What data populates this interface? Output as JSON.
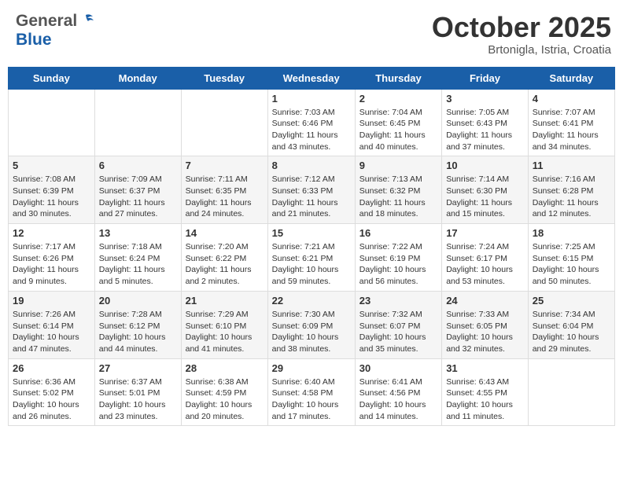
{
  "header": {
    "logo_general": "General",
    "logo_blue": "Blue",
    "month": "October 2025",
    "location": "Brtonigla, Istria, Croatia"
  },
  "weekdays": [
    "Sunday",
    "Monday",
    "Tuesday",
    "Wednesday",
    "Thursday",
    "Friday",
    "Saturday"
  ],
  "weeks": [
    [
      {
        "day": "",
        "info": ""
      },
      {
        "day": "",
        "info": ""
      },
      {
        "day": "",
        "info": ""
      },
      {
        "day": "1",
        "info": "Sunrise: 7:03 AM\nSunset: 6:46 PM\nDaylight: 11 hours\nand 43 minutes."
      },
      {
        "day": "2",
        "info": "Sunrise: 7:04 AM\nSunset: 6:45 PM\nDaylight: 11 hours\nand 40 minutes."
      },
      {
        "day": "3",
        "info": "Sunrise: 7:05 AM\nSunset: 6:43 PM\nDaylight: 11 hours\nand 37 minutes."
      },
      {
        "day": "4",
        "info": "Sunrise: 7:07 AM\nSunset: 6:41 PM\nDaylight: 11 hours\nand 34 minutes."
      }
    ],
    [
      {
        "day": "5",
        "info": "Sunrise: 7:08 AM\nSunset: 6:39 PM\nDaylight: 11 hours\nand 30 minutes."
      },
      {
        "day": "6",
        "info": "Sunrise: 7:09 AM\nSunset: 6:37 PM\nDaylight: 11 hours\nand 27 minutes."
      },
      {
        "day": "7",
        "info": "Sunrise: 7:11 AM\nSunset: 6:35 PM\nDaylight: 11 hours\nand 24 minutes."
      },
      {
        "day": "8",
        "info": "Sunrise: 7:12 AM\nSunset: 6:33 PM\nDaylight: 11 hours\nand 21 minutes."
      },
      {
        "day": "9",
        "info": "Sunrise: 7:13 AM\nSunset: 6:32 PM\nDaylight: 11 hours\nand 18 minutes."
      },
      {
        "day": "10",
        "info": "Sunrise: 7:14 AM\nSunset: 6:30 PM\nDaylight: 11 hours\nand 15 minutes."
      },
      {
        "day": "11",
        "info": "Sunrise: 7:16 AM\nSunset: 6:28 PM\nDaylight: 11 hours\nand 12 minutes."
      }
    ],
    [
      {
        "day": "12",
        "info": "Sunrise: 7:17 AM\nSunset: 6:26 PM\nDaylight: 11 hours\nand 9 minutes."
      },
      {
        "day": "13",
        "info": "Sunrise: 7:18 AM\nSunset: 6:24 PM\nDaylight: 11 hours\nand 5 minutes."
      },
      {
        "day": "14",
        "info": "Sunrise: 7:20 AM\nSunset: 6:22 PM\nDaylight: 11 hours\nand 2 minutes."
      },
      {
        "day": "15",
        "info": "Sunrise: 7:21 AM\nSunset: 6:21 PM\nDaylight: 10 hours\nand 59 minutes."
      },
      {
        "day": "16",
        "info": "Sunrise: 7:22 AM\nSunset: 6:19 PM\nDaylight: 10 hours\nand 56 minutes."
      },
      {
        "day": "17",
        "info": "Sunrise: 7:24 AM\nSunset: 6:17 PM\nDaylight: 10 hours\nand 53 minutes."
      },
      {
        "day": "18",
        "info": "Sunrise: 7:25 AM\nSunset: 6:15 PM\nDaylight: 10 hours\nand 50 minutes."
      }
    ],
    [
      {
        "day": "19",
        "info": "Sunrise: 7:26 AM\nSunset: 6:14 PM\nDaylight: 10 hours\nand 47 minutes."
      },
      {
        "day": "20",
        "info": "Sunrise: 7:28 AM\nSunset: 6:12 PM\nDaylight: 10 hours\nand 44 minutes."
      },
      {
        "day": "21",
        "info": "Sunrise: 7:29 AM\nSunset: 6:10 PM\nDaylight: 10 hours\nand 41 minutes."
      },
      {
        "day": "22",
        "info": "Sunrise: 7:30 AM\nSunset: 6:09 PM\nDaylight: 10 hours\nand 38 minutes."
      },
      {
        "day": "23",
        "info": "Sunrise: 7:32 AM\nSunset: 6:07 PM\nDaylight: 10 hours\nand 35 minutes."
      },
      {
        "day": "24",
        "info": "Sunrise: 7:33 AM\nSunset: 6:05 PM\nDaylight: 10 hours\nand 32 minutes."
      },
      {
        "day": "25",
        "info": "Sunrise: 7:34 AM\nSunset: 6:04 PM\nDaylight: 10 hours\nand 29 minutes."
      }
    ],
    [
      {
        "day": "26",
        "info": "Sunrise: 6:36 AM\nSunset: 5:02 PM\nDaylight: 10 hours\nand 26 minutes."
      },
      {
        "day": "27",
        "info": "Sunrise: 6:37 AM\nSunset: 5:01 PM\nDaylight: 10 hours\nand 23 minutes."
      },
      {
        "day": "28",
        "info": "Sunrise: 6:38 AM\nSunset: 4:59 PM\nDaylight: 10 hours\nand 20 minutes."
      },
      {
        "day": "29",
        "info": "Sunrise: 6:40 AM\nSunset: 4:58 PM\nDaylight: 10 hours\nand 17 minutes."
      },
      {
        "day": "30",
        "info": "Sunrise: 6:41 AM\nSunset: 4:56 PM\nDaylight: 10 hours\nand 14 minutes."
      },
      {
        "day": "31",
        "info": "Sunrise: 6:43 AM\nSunset: 4:55 PM\nDaylight: 10 hours\nand 11 minutes."
      },
      {
        "day": "",
        "info": ""
      }
    ]
  ]
}
